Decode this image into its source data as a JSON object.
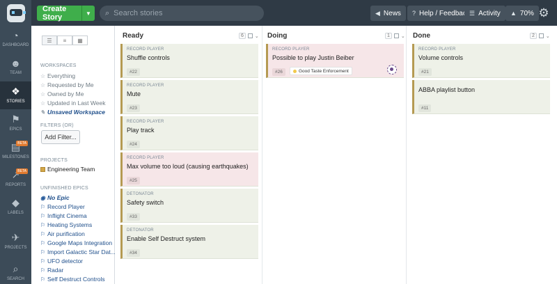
{
  "topbar": {
    "create_label": "Create Story",
    "search_placeholder": "Search stories",
    "news": "News",
    "help": "Help / Feedback",
    "activity": "Activity",
    "progress": "70%"
  },
  "nav": [
    {
      "label": "DASHBOARD",
      "icon": "dashboard-icon"
    },
    {
      "label": "TEAM",
      "icon": "team-icon"
    },
    {
      "label": "STORIES",
      "icon": "stories-icon",
      "active": true
    },
    {
      "label": "EPICS",
      "icon": "epics-icon"
    },
    {
      "label": "MILESTONES",
      "icon": "milestones-icon",
      "beta": "BETA"
    },
    {
      "label": "REPORTS",
      "icon": "reports-icon",
      "beta": "BETA"
    },
    {
      "label": "LABELS",
      "icon": "labels-icon"
    },
    {
      "label": "PROJECTS",
      "icon": "projects-icon"
    },
    {
      "label": "SEARCH",
      "icon": "search-icon"
    }
  ],
  "sidebar": {
    "workspaces_heading": "WORKSPACES",
    "workspaces": [
      "Everything",
      "Requested by Me",
      "Owned by Me",
      "Updated in Last Week"
    ],
    "unsaved": "Unsaved Workspace",
    "filters_heading": "FILTERS (OR)",
    "add_filter": "Add Filter...",
    "projects_heading": "PROJECTS",
    "project": "Engineering Team",
    "epics_heading": "UNFINISHED EPICS",
    "no_epic": "No Epic",
    "epics": [
      "Record Player",
      "Inflight Cinema",
      "Heating Systems",
      "Air purification",
      "Google Maps Integration",
      "Import Galactic Star Dat...",
      "UFO detector",
      "Radar",
      "Self Destruct Controls"
    ]
  },
  "columns": [
    {
      "name": "Ready",
      "count": "6",
      "cards": [
        {
          "epic": "RECORD PLAYER",
          "title": "Shuffle controls",
          "num": "#22",
          "red": false
        },
        {
          "epic": "RECORD PLAYER",
          "title": "Mute",
          "num": "#23",
          "red": false
        },
        {
          "epic": "RECORD PLAYER",
          "title": "Play track",
          "num": "#24",
          "red": false
        },
        {
          "epic": "RECORD PLAYER",
          "title": "Max volume too loud (causing earthquakes)",
          "num": "#25",
          "red": true
        },
        {
          "epic": "DETONATOR",
          "title": "Safety switch",
          "num": "#33",
          "red": false
        },
        {
          "epic": "DETONATOR",
          "title": "Enable Self Destruct system",
          "num": "#34",
          "red": false
        }
      ]
    },
    {
      "name": "Doing",
      "count": "1",
      "cards": [
        {
          "epic": "RECORD PLAYER",
          "title": "Possible to play Justin Beiber",
          "num": "#26",
          "red": true,
          "label": "Good Taste Enforcement"
        }
      ]
    },
    {
      "name": "Done",
      "count": "2",
      "cards": [
        {
          "epic": "RECORD PLAYER",
          "title": "Volume controls",
          "num": "#21",
          "red": false
        },
        {
          "epic": "",
          "title": "ABBA playlist button",
          "num": "#11",
          "red": false
        }
      ]
    }
  ]
}
